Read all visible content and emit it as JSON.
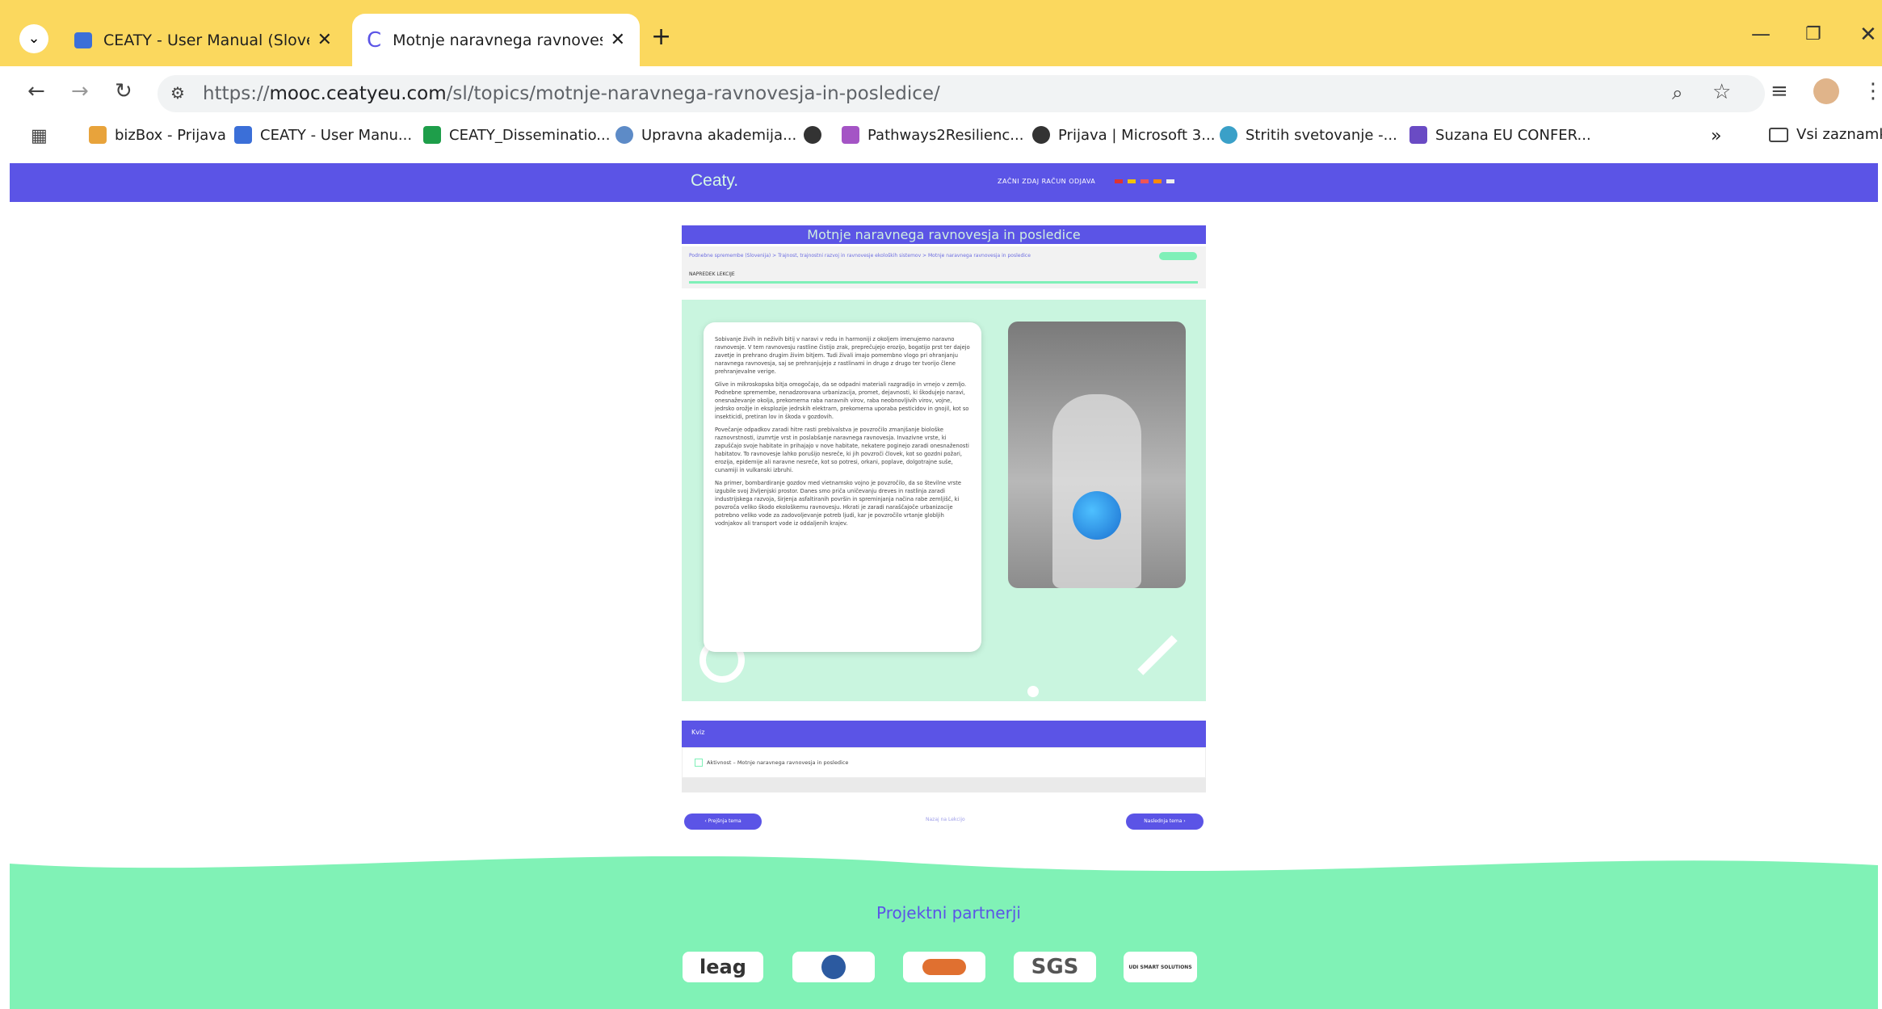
{
  "browser": {
    "tabs": [
      {
        "label": "CEATY - User Manual (Slovenia)"
      },
      {
        "label": "Motnje naravnega ravnovesja in posledice"
      }
    ],
    "url_prefix": "https://",
    "url_domain": "mooc.ceatyeu.com",
    "url_path": "/sl/topics/motnje-naravnega-ravnovesja-in-posledice/",
    "bookmarks": [
      "bizBox - Prijava",
      "CEATY - User Manu...",
      "CEATY_Disseminatio...",
      "Upravna akademija...",
      "Pathways2Resilienc...",
      "Prijava | Microsoft 3...",
      "Stritih svetovanje -...",
      "Suzana EU CONFER..."
    ],
    "bookmarks_overflow": "»",
    "all_bookmarks": "Vsi zaznamki"
  },
  "site": {
    "logo": "Ceaty.",
    "nav": "ZAČNI ZDAJ   RAČUN   ODJAVA",
    "lesson_title": "Motnje naravnega ravnovesja in posledice",
    "breadcrumb": "Podnebne spremembe (Slovenija) > Trajnost, trajnostni razvoj in ravnovesje ekoloških sistemov > Motnje naravnega ravnovesja in posledice",
    "progress_label": "NAPREDEK LEKCIJE",
    "paragraphs": [
      "Sobivanje živih in neživih bitij v naravi v redu in harmoniji z okoljem imenujemo naravno ravnovesje. V tem ravnovesju rastline čistijo zrak, preprečujejo erozijo, bogatijo prst ter dajejo zavetje in prehrano drugim živim bitjem. Tudi živali imajo pomembno vlogo pri ohranjanju naravnega ravnovesja, saj se prehranjujejo z rastlinami in drugo z drugo ter tvorijo člene prehranjevalne verige.",
      "Glive in mikroskopska bitja omogočajo, da se odpadni materiali razgradijo in vrnejo v zemljo. Podnebne spremembe, nenadzorovana urbanizacija, promet, dejavnosti, ki škodujejo naravi, onesnaževanje okolja, prekomerna raba naravnih virov, raba neobnovljivih virov, vojne, jedrsko orožje in eksplozije jedrskih elektrarn, prekomerna uporaba pesticidov in gnojil, kot so insekticidi, pretiran lov in škoda v gozdovih.",
      "Povečanje odpadkov zaradi hitre rasti prebivalstva je povzročilo zmanjšanje biološke raznovrstnosti, izumrtje vrst in poslabšanje naravnega ravnovesja. Invazivne vrste, ki zapuščajo svoje habitate in prihajajo v nove habitate, nekatere poginejo zaradi onesnaženosti habitatov. To ravnovesje lahko porušijo nesreče, ki jih povzroči človek, kot so gozdni požari, erozija, epidemije ali naravne nesreče, kot so potresi, orkani, poplave, dolgotrajne suše, cunamiji in vulkanski izbruhi.",
      "Na primer, bombardiranje gozdov med vietnamsko vojno je povzročilo, da so številne vrste izgubile svoj življenjski prostor. Danes smo priča uničevanju dreves in rastlinja zaradi industrijskega razvoja, širjenja asfaltiranih površin in spreminjanja načina rabe zemljišč, ki povzroča veliko škodo ekološkemu ravnovesju. Hkrati je zaradi naraščajoče urbanizacije potrebno veliko vode za zadovoljevanje potreb ljudi, kar je povzročilo vrtanje globljih vodnjakov ali transport vode iz oddaljenih krajev."
    ],
    "quiz_header": "Kviz",
    "quiz_item": "Aktivnost – Motnje naravnega ravnovesja in posledice",
    "prev_label": "‹  Prejšnja tema",
    "next_label": "Naslednja tema  ›",
    "back_label": "Nazaj na Lekcijo",
    "partners_title": "Projektni partnerji",
    "partner_logos": [
      "leag",
      "",
      "",
      "SGS",
      "UDI SMART SOLUTIONS"
    ]
  },
  "colors": {
    "tabbar": "#fbd85e",
    "site_primary": "#5b54e6",
    "mint": "#80f2b6",
    "content_bg": "#c9f5df"
  }
}
